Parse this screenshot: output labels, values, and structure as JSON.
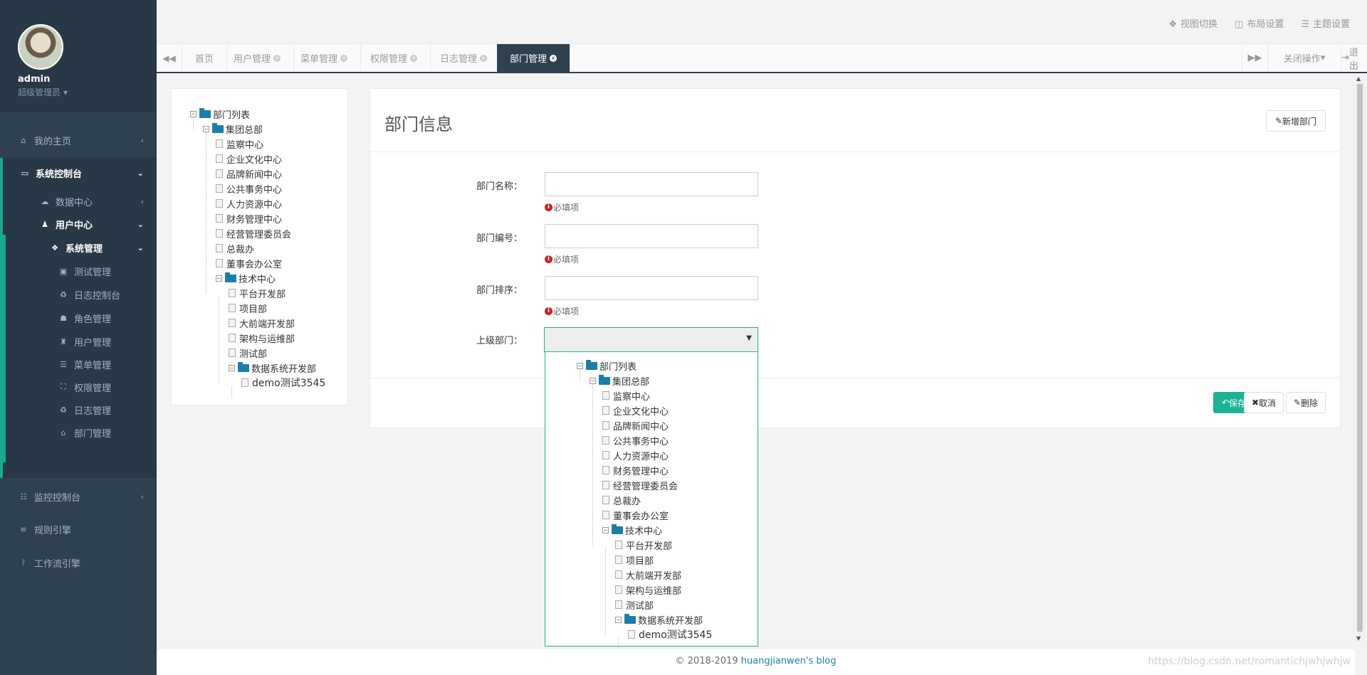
{
  "user": {
    "name": "admin",
    "role": "超级管理员"
  },
  "sidebar": {
    "items": [
      {
        "label": "我的主页",
        "icon": "home-icon",
        "glyph": "⌂"
      },
      {
        "label": "系统控制台",
        "icon": "monitor-icon",
        "glyph": "▭"
      },
      {
        "label": "数据中心",
        "icon": "cloud-icon",
        "glyph": "☁"
      },
      {
        "label": "用户中心",
        "icon": "user-icon",
        "glyph": "♟"
      },
      {
        "label": "系统管理",
        "icon": "dropbox-icon",
        "glyph": "❖"
      },
      {
        "label": "测试管理",
        "icon": "test-icon",
        "glyph": "▣"
      },
      {
        "label": "日志控制台",
        "icon": "recycle-icon",
        "glyph": "♻"
      },
      {
        "label": "角色管理",
        "icon": "users-icon",
        "glyph": "☗"
      },
      {
        "label": "用户管理",
        "icon": "lock-icon",
        "glyph": "♜"
      },
      {
        "label": "菜单管理",
        "icon": "list-icon",
        "glyph": "☰"
      },
      {
        "label": "权限管理",
        "icon": "sitemap-icon",
        "glyph": "⛶"
      },
      {
        "label": "日志管理",
        "icon": "recycle-icon",
        "glyph": "♻"
      },
      {
        "label": "部门管理",
        "icon": "bank-icon",
        "glyph": "⌂"
      },
      {
        "label": "监控控制台",
        "icon": "tasks-icon",
        "glyph": "☷"
      },
      {
        "label": "规则引擎",
        "icon": "database-icon",
        "glyph": "≡"
      },
      {
        "label": "工作流引擎",
        "icon": "paypal-icon",
        "glyph": "ᚹ"
      }
    ]
  },
  "topbar": {
    "view_switch": "视图切换",
    "layout_settings": "布局设置",
    "theme_settings": "主题设置"
  },
  "tabs": [
    "首页",
    "用户管理",
    "菜单管理",
    "权限管理",
    "日志管理",
    "部门管理"
  ],
  "tabbar": {
    "close_ops": "关闭操作",
    "logout": "退出"
  },
  "tree": {
    "root": "部门列表",
    "hq": "集团总部",
    "hq_children": [
      "监察中心",
      "企业文化中心",
      "品牌新闻中心",
      "公共事务中心",
      "人力资源中心",
      "财务管理中心",
      "经营管理委员会",
      "总裁办",
      "董事会办公室"
    ],
    "tech": "技术中心",
    "tech_children": [
      "平台开发部",
      "项目部",
      "大前端开发部",
      "架构与运维部",
      "测试部"
    ],
    "data": "数据系统开发部",
    "data_children": [
      "demo测试3545"
    ]
  },
  "form": {
    "title": "部门信息",
    "add_button": "新增部门",
    "fields": [
      {
        "label": "部门名称：",
        "value": "",
        "hint": "必填项"
      },
      {
        "label": "部门编号：",
        "value": "",
        "hint": "必填项"
      },
      {
        "label": "部门排序：",
        "value": "",
        "hint": "必填项"
      }
    ],
    "parent_label": "上级部门：",
    "parent_value": "",
    "save": "保存",
    "cancel": "取消",
    "delete": "删除"
  },
  "footer": {
    "copyright": "© 2018-2019",
    "blog": "huangjianwen's blog",
    "watermark": "https://blog.csdn.net/romantichjwhjwhjw"
  },
  "colors": {
    "sidebar": "#2f4050",
    "accent": "#1ab394",
    "folder": "#1a7fa8",
    "required": "#cc1f1f"
  }
}
